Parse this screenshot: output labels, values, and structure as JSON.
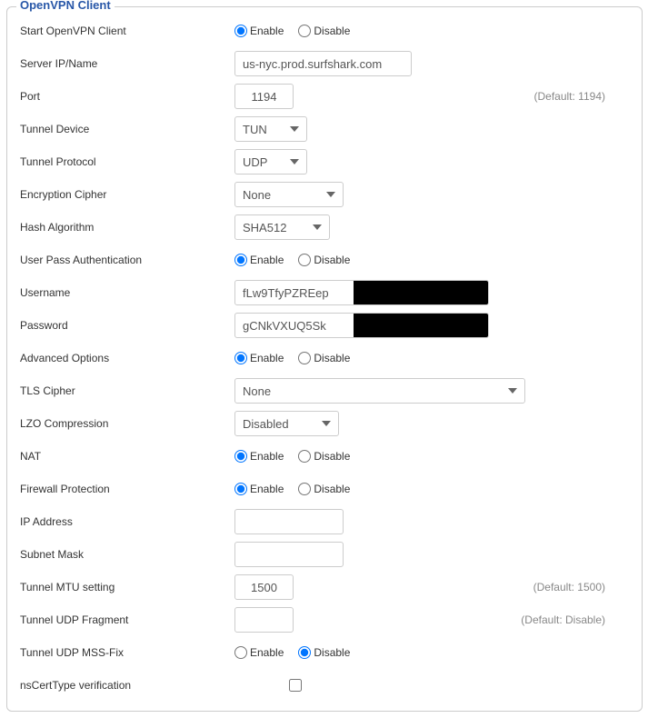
{
  "legend": "OpenVPN Client",
  "labels": {
    "enable": "Enable",
    "disable": "Disable"
  },
  "fields": {
    "start": {
      "label": "Start OpenVPN Client"
    },
    "server": {
      "label": "Server IP/Name",
      "value": "us-nyc.prod.surfshark.com"
    },
    "port": {
      "label": "Port",
      "value": "1194",
      "hint": "(Default: 1194)"
    },
    "tunnelDevice": {
      "label": "Tunnel Device",
      "value": "TUN"
    },
    "tunnelProtocol": {
      "label": "Tunnel Protocol",
      "value": "UDP"
    },
    "cipher": {
      "label": "Encryption Cipher",
      "value": "None"
    },
    "hash": {
      "label": "Hash Algorithm",
      "value": "SHA512"
    },
    "userPass": {
      "label": "User Pass Authentication"
    },
    "username": {
      "label": "Username",
      "value": "fLw9TfyPZREep"
    },
    "password": {
      "label": "Password",
      "value": "gCNkVXUQ5Sk"
    },
    "advanced": {
      "label": "Advanced Options"
    },
    "tlsCipher": {
      "label": "TLS Cipher",
      "value": "None"
    },
    "lzo": {
      "label": "LZO Compression",
      "value": "Disabled"
    },
    "nat": {
      "label": "NAT"
    },
    "firewall": {
      "label": "Firewall Protection"
    },
    "ipAddress": {
      "label": "IP Address",
      "value": ""
    },
    "subnet": {
      "label": "Subnet Mask",
      "value": ""
    },
    "mtu": {
      "label": "Tunnel MTU setting",
      "value": "1500",
      "hint": "(Default: 1500)"
    },
    "udpFragment": {
      "label": "Tunnel UDP Fragment",
      "value": "",
      "hint": "(Default: Disable)"
    },
    "mssFix": {
      "label": "Tunnel UDP MSS-Fix"
    },
    "nsCert": {
      "label": "nsCertType verification"
    }
  }
}
